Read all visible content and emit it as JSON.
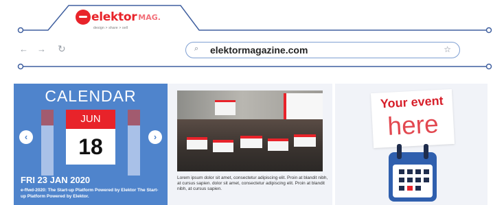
{
  "browser": {
    "logo": {
      "main": "elektor",
      "suffix": "MAG.",
      "tagline": "design > share > sell"
    },
    "nav": {
      "back_icon": "←",
      "forward_icon": "→",
      "reload_icon": "↻"
    },
    "address_bar": {
      "url": "elektormagazine.com",
      "search_icon": "⌕",
      "star_icon": "☆"
    }
  },
  "calendar": {
    "title": "CALENDAR",
    "month": "JUN",
    "day": "18",
    "prev_icon": "‹",
    "next_icon": "›",
    "event_date": "FRI 23 JAN 2020",
    "event_description": "e-ffwd-2020: The Start-up Platform Powered by Elektor The Start-up Platform Powered by Elektor."
  },
  "news": {
    "text": "Lorem ipsum dolor sit amet, consectetur adipiscing elit. Proin at blandit nibh, at cursus sapien. dolor sit amet, consectetur adipiscing elit. Proin at blandit nibh, at cursus sapien."
  },
  "promo": {
    "line1": "Your event",
    "line2": "here"
  },
  "colors": {
    "brand_red": "#e8232a",
    "accent_blue": "#4f84cc",
    "chrome_line": "#3f5f9f"
  }
}
